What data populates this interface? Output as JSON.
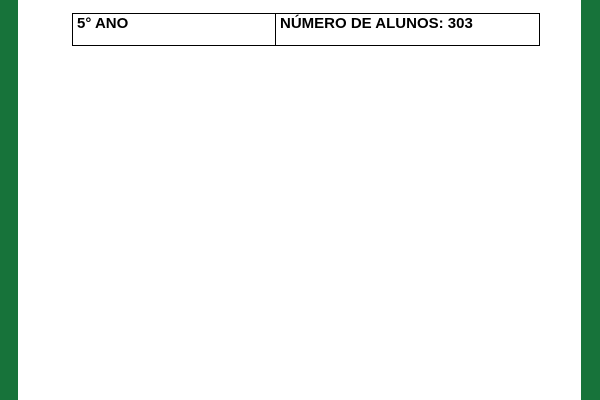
{
  "colors": {
    "border_green": "#17733a",
    "background": "#ffffff",
    "text": "#000000"
  },
  "table": {
    "grade": "5° ANO",
    "student_count": "NÚMERO DE ALUNOS: 303"
  }
}
